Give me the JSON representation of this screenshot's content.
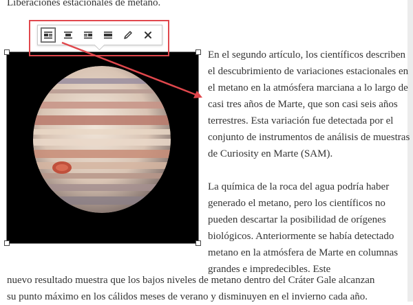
{
  "heading_partial": "Liberaciones estacionales de metano.",
  "toolbar": {
    "buttons": [
      {
        "name": "align-left",
        "icon": "align-left-icon",
        "active": true
      },
      {
        "name": "align-center",
        "icon": "align-center-icon",
        "active": false
      },
      {
        "name": "align-right",
        "icon": "align-right-icon",
        "active": false
      },
      {
        "name": "align-none",
        "icon": "align-none-icon",
        "active": false
      },
      {
        "name": "edit",
        "icon": "pencil-icon",
        "active": false
      },
      {
        "name": "remove",
        "icon": "close-icon",
        "active": false
      }
    ]
  },
  "image": {
    "subject": "jupiter-planet-image"
  },
  "content": {
    "para1": "En el segundo artículo, los científicos describen el descubrimiento de variaciones estacionales en el metano en la atmósfera marciana a lo largo de casi tres años de Marte, que son casi seis años terrestres. Esta variación fue detectada por el conjunto de instrumentos de análisis de muestras de Curiosity en Marte (SAM).",
    "para2": "La química de la roca del agua podría haber generado el metano, pero los científicos no pueden descartar la posibilidad de orígenes biológicos. Anteriormente se había detectado metano en la atmósfera de Marte en columnas grandes e impredecibles. Este",
    "para2_tail_1": "nuevo resultado muestra que los bajos niveles de metano dentro del Cráter Gale alcanzan",
    "para2_tail_2": "su punto máximo en los cálidos meses de verano y disminuyen en el invierno cada año."
  },
  "colors": {
    "highlight": "#e0474c",
    "text": "#333333"
  }
}
